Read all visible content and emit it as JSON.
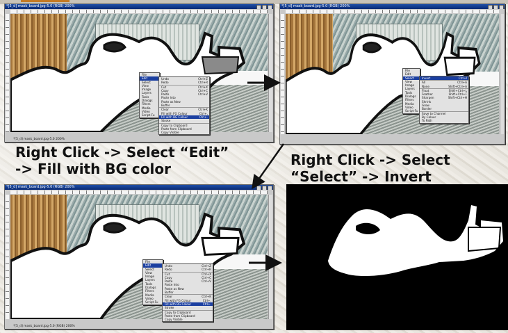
{
  "accent_color": "#c47a25",
  "windows": [
    {
      "title": "*[5_d] mask_board.jpg-5.0 (RGB) 200%",
      "status": "*[5_d] mask_board.jpg-5.0 200%"
    },
    {
      "title": "*[5_d] mask_board.jpg-5.0 (RGB) 200%",
      "status": ""
    },
    {
      "title": "*[5_d] mask_board.jpg-5.0 (RGB) 200%",
      "status": "*[5_d] mask_board.jpg-5.0 (RGB) 200%"
    }
  ],
  "main_menu": [
    "File",
    "Edit",
    "Select",
    "View",
    "Image",
    "Layers",
    "Tools",
    "Dialogs",
    "Filters",
    "Media",
    "Video",
    "Script-Fu"
  ],
  "edit_menu": [
    {
      "label": "Undo",
      "shortcut": "Ctrl+Z"
    },
    {
      "label": "Redo",
      "shortcut": "Ctrl+R"
    },
    {
      "label": "Cut",
      "shortcut": "Ctrl+X"
    },
    {
      "label": "Copy",
      "shortcut": "Ctrl+C"
    },
    {
      "label": "Paste",
      "shortcut": "Ctrl+V"
    },
    {
      "label": "Paste Into",
      "shortcut": ""
    },
    {
      "label": "Paste as New",
      "shortcut": ""
    },
    {
      "label": "Buffer",
      "shortcut": ""
    },
    {
      "label": "Clear",
      "shortcut": "Ctrl+K"
    },
    {
      "label": "Fill with FG Colour",
      "shortcut": "Ctrl+,"
    },
    {
      "label": "Fill with BG Colour",
      "shortcut": "Ctrl+."
    },
    {
      "label": "Stroke",
      "shortcut": ""
    },
    {
      "label": "Copy to Clipboard",
      "shortcut": ""
    },
    {
      "label": "Paste from Clipboard",
      "shortcut": ""
    },
    {
      "label": "Copy Visible",
      "shortcut": ""
    }
  ],
  "select_menu": [
    {
      "label": "Invert",
      "shortcut": "Ctrl+I"
    },
    {
      "label": "All",
      "shortcut": "Ctrl+A"
    },
    {
      "label": "None",
      "shortcut": "Shift+Ctrl+A"
    },
    {
      "label": "Float",
      "shortcut": "Shift+Ctrl+L"
    },
    {
      "label": "Feather",
      "shortcut": "Shift+Ctrl+F"
    },
    {
      "label": "Sharpen",
      "shortcut": "Shift+Ctrl+H"
    },
    {
      "label": "Shrink",
      "shortcut": ""
    },
    {
      "label": "Grow",
      "shortcut": ""
    },
    {
      "label": "Border",
      "shortcut": ""
    },
    {
      "label": "Save to Channel",
      "shortcut": ""
    },
    {
      "label": "By Colour",
      "shortcut": ""
    },
    {
      "label": "To Path",
      "shortcut": ""
    }
  ],
  "labels": {
    "step1_line1": "Right Click -> Select “Edit”",
    "step1_line2": "-> Fill with BG color",
    "step2_line1": "Right Click -> Select",
    "step2_line2": "“Select” -> Invert"
  }
}
